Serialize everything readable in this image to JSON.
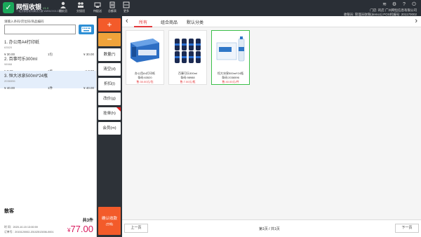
{
  "app": {
    "title": "网恒收银",
    "version": "V1.0",
    "subtitle": "一站式零售软件解决方案 WWW.XXX.COM"
  },
  "topnav": [
    {
      "label": "提交员",
      "icon": "user-icon"
    },
    {
      "label": "交接班",
      "icon": "handover-icon"
    },
    {
      "label": "待配送",
      "icon": "delivery-icon"
    },
    {
      "label": "总额表",
      "icon": "report-icon"
    },
    {
      "label": "更多",
      "icon": "more-icon"
    }
  ],
  "shop": {
    "line1": "门店: 的店 广州网恒信息有限公司",
    "line2": "收银员: 管理员收银(demo1)  POS机编号: 201170002"
  },
  "cart": {
    "search_hint": "请输入条码/货位码/商品编码",
    "search_placeholder": "",
    "items": [
      {
        "name": "1. 办公用A4打印纸",
        "code": "63520",
        "price": "¥ 30.00",
        "qty": "1包",
        "total": "¥ 30.00"
      },
      {
        "name": "2. 百事可乐300ml",
        "code": "98988",
        "price": "¥ 7.00",
        "qty": "1瓶",
        "total": "¥ 7.00"
      },
      {
        "name": "3. 恒大冰泉500ml*24瓶",
        "code": "2036596",
        "price": "¥ 40.00",
        "qty": "1件",
        "total": "¥ 40.00"
      }
    ],
    "customer": "散客",
    "count_label": "共3件",
    "time_label": "时   间：2020-10-15  13:00:59",
    "order_label": "订单号：2015120002-20102513006-0001",
    "grand_symbol": "¥",
    "grand_total": "77.00"
  },
  "actions": {
    "plus": "+",
    "minus": "−",
    "items": [
      {
        "label": "数量(*)"
      },
      {
        "label": "清空(d)"
      },
      {
        "label": "折扣(i)"
      },
      {
        "label": "改价(g)"
      },
      {
        "label": "挂单(h)"
      },
      {
        "label": "会员(m)"
      }
    ],
    "settle_label": "确认收款",
    "settle_key": "(空格)"
  },
  "tabs": [
    "所有",
    "组合商品",
    "默认分类"
  ],
  "products": [
    {
      "name": "办公用A4打印纸",
      "code": "条码:63520",
      "price": "售:30.00元/包"
    },
    {
      "name": "百事可乐300ml",
      "code": "条码:98988",
      "price": "售:7.00元/瓶"
    },
    {
      "name": "恒大冰泉500ml*24瓶",
      "code": "条码:2036596",
      "price": "售:40.00元/件"
    }
  ],
  "pager": {
    "prev": "上一页",
    "next": "下一页",
    "info": "第1页 / 共1页"
  },
  "colors": {
    "accent_red": "#e4393c",
    "orange": "#f35b2a",
    "dark": "#2a2f36",
    "blue": "#2d8fd5",
    "total_pink": "#d8175b"
  }
}
